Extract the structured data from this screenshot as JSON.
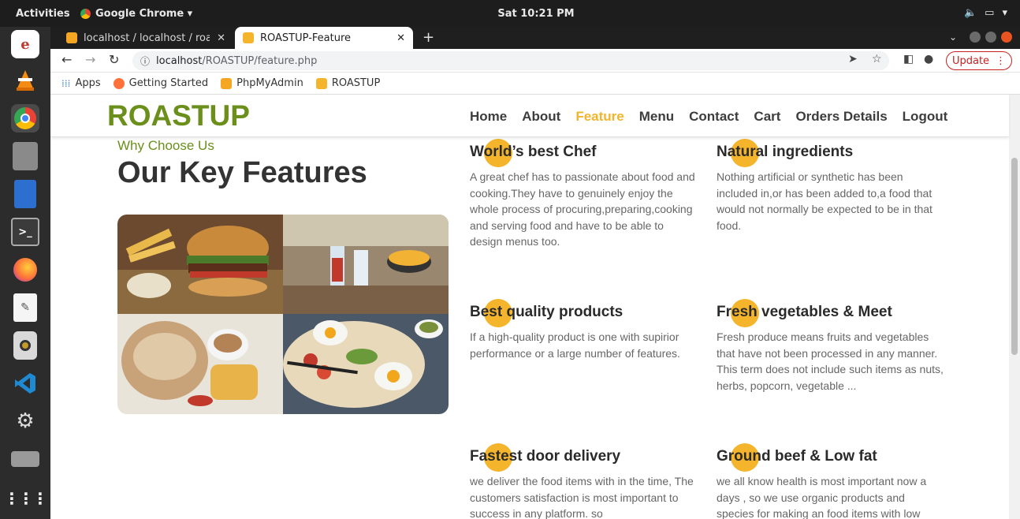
{
  "topbar": {
    "activities": "Activities",
    "app_name": "Google Chrome ▾",
    "clock": "Sat 10:21 PM"
  },
  "dock": {
    "items": [
      "app-icon",
      "vlc-icon",
      "chrome-icon",
      "files-icon",
      "document-icon",
      "terminal-icon",
      "firefox-icon",
      "text-editor-icon",
      "audio-icon",
      "vscode-icon",
      "settings-icon",
      "scanner-icon",
      "apps-grid-icon"
    ]
  },
  "browser": {
    "tabs": [
      {
        "title": "localhost / localhost / roa",
        "favicon_color": "#f5a623"
      },
      {
        "title": "ROASTUP-Feature",
        "favicon_color": "#f4b42b"
      }
    ],
    "url_host": "localhost",
    "url_path": "/ROASTUP/feature.php",
    "update_label": "Update",
    "bookmarks": [
      {
        "label": "Apps",
        "icon": "apps-grid-icon"
      },
      {
        "label": "Getting Started",
        "icon": "firefox-icon"
      },
      {
        "label": "PhpMyAdmin",
        "icon": "phpmyadmin-icon"
      },
      {
        "label": "ROASTUP",
        "icon": "roastup-icon"
      }
    ]
  },
  "site": {
    "logo": "ROASTUP",
    "brand_color": "#6a8f1a",
    "accent_color": "#f4b42b",
    "nav": [
      "Home",
      "About",
      "Feature",
      "Menu",
      "Contact",
      "Cart",
      "Orders Details",
      "Logout"
    ],
    "nav_active": "Feature",
    "subtitle": "Why Choose Us",
    "heading": "Our Key Features",
    "features": [
      {
        "title": "World’s best Chef",
        "text": "A great chef has to passionate about food and cooking.They have to genuinely enjoy the whole process of procuring,preparing,cooking and serving food and have to be able to design menus too."
      },
      {
        "title": "Natural ingredients",
        "text": "Nothing artificial or synthetic has been included in,or has been added to,a food that would not normally be expected to be in that food."
      },
      {
        "title": "Best quality products",
        "text": "If a high-quality product is one with supirior performance or a large number of features."
      },
      {
        "title": "Fresh vegetables & Meet",
        "text": "Fresh produce means fruits and vegetables that have not been processed in any manner. This term does not include such items as nuts, herbs, popcorn, vegetable ..."
      },
      {
        "title": "Fastest door delivery",
        "text": "we deliver the food items with in the time, The customers satisfaction is most important to success in any platform. so"
      },
      {
        "title": "Ground beef & Low fat",
        "text": "we all know health is most important now a days , so we use organic products and species for making an food items with low"
      }
    ]
  }
}
